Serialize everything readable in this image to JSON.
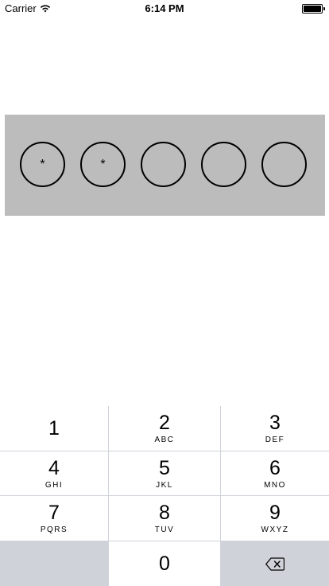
{
  "status_bar": {
    "carrier": "Carrier",
    "time": "6:14 PM"
  },
  "pin": {
    "entries": [
      "*",
      "*",
      "",
      "",
      ""
    ]
  },
  "keypad": {
    "keys": [
      {
        "num": "1",
        "letters": ""
      },
      {
        "num": "2",
        "letters": "ABC"
      },
      {
        "num": "3",
        "letters": "DEF"
      },
      {
        "num": "4",
        "letters": "GHI"
      },
      {
        "num": "5",
        "letters": "JKL"
      },
      {
        "num": "6",
        "letters": "MNO"
      },
      {
        "num": "7",
        "letters": "PQRS"
      },
      {
        "num": "8",
        "letters": "TUV"
      },
      {
        "num": "9",
        "letters": "WXYZ"
      },
      {
        "num": "0",
        "letters": ""
      }
    ],
    "delete_icon": "backspace-icon"
  }
}
